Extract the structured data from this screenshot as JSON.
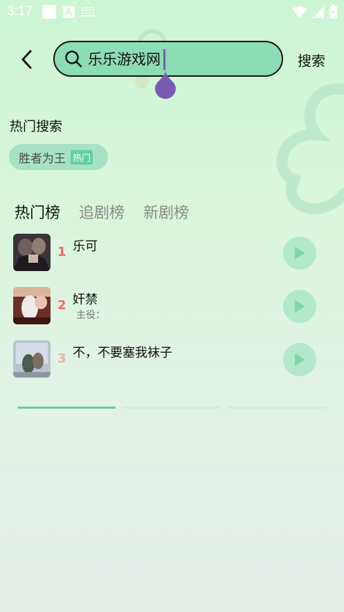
{
  "status_bar": {
    "time": "3:17",
    "icons_left": [
      "square-icon",
      "a-box-icon",
      "keyboard-icon"
    ],
    "icons_right": [
      "wifi-icon",
      "signal-icon",
      "battery-icon"
    ]
  },
  "header": {
    "back_icon": "back-arrow-icon",
    "search": {
      "value": "乐乐游戏网",
      "icon": "search-icon"
    },
    "search_button": "搜索"
  },
  "hot_search": {
    "title": "热门搜索",
    "chips": [
      {
        "label": "胜者为王",
        "badge": "热门"
      }
    ]
  },
  "tabs": [
    "热门榜",
    "追剧榜",
    "新剧榜"
  ],
  "ranking": [
    {
      "rank": "1",
      "title": "乐可",
      "subtitle": ""
    },
    {
      "rank": "2",
      "title": "奸禁",
      "subtitle": "主役："
    },
    {
      "rank": "3",
      "title": "不，不要塞我袜子",
      "subtitle": ""
    }
  ],
  "colors": {
    "accent": "#62cfa1",
    "search_fill": "#8cdcb5",
    "rank_red": "#f06a6a",
    "rank_third": "#f4b0a3",
    "play_button": "#b3e8cd",
    "caret": "#7a5bb3"
  }
}
